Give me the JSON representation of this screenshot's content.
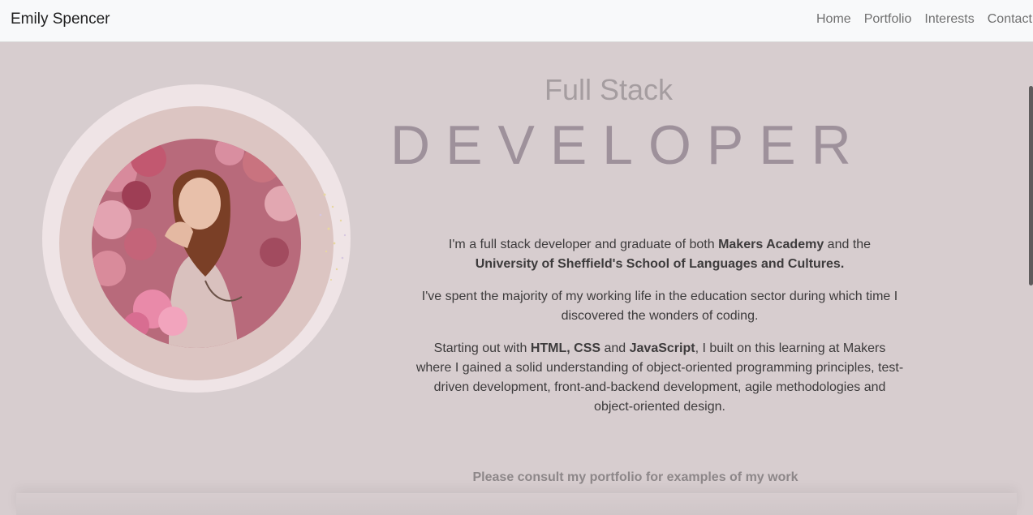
{
  "navbar": {
    "brand": "Emily Spencer",
    "links": [
      "Home",
      "Portfolio",
      "Interests",
      "Contact"
    ]
  },
  "hero": {
    "subtitle": "Full Stack",
    "title": "DEVELOPER"
  },
  "bio": {
    "p1": {
      "t1": "I'm a full stack developer and graduate of both ",
      "b1": "Makers Academy",
      "t2": " and the ",
      "b2": "University of Sheffield's School of Languages and Cultures."
    },
    "p2": "I've spent the majority of my working life in the education sector during which time I discovered the wonders of coding.",
    "p3": {
      "t1": "Starting out with ",
      "b1": "HTML, CSS",
      "t2": " and ",
      "b2": "JavaScript",
      "t3": ", I built on this learning at Makers where I gained a solid understanding of object-oriented programming principles, test-driven development, front-and-backend development, agile methodologies and object-oriented design."
    }
  },
  "cta": "Please consult my portfolio for examples of my work",
  "colors": {
    "background": "#d7cdcf",
    "navbar": "#f8f9fa",
    "accent": "#9e919b"
  }
}
